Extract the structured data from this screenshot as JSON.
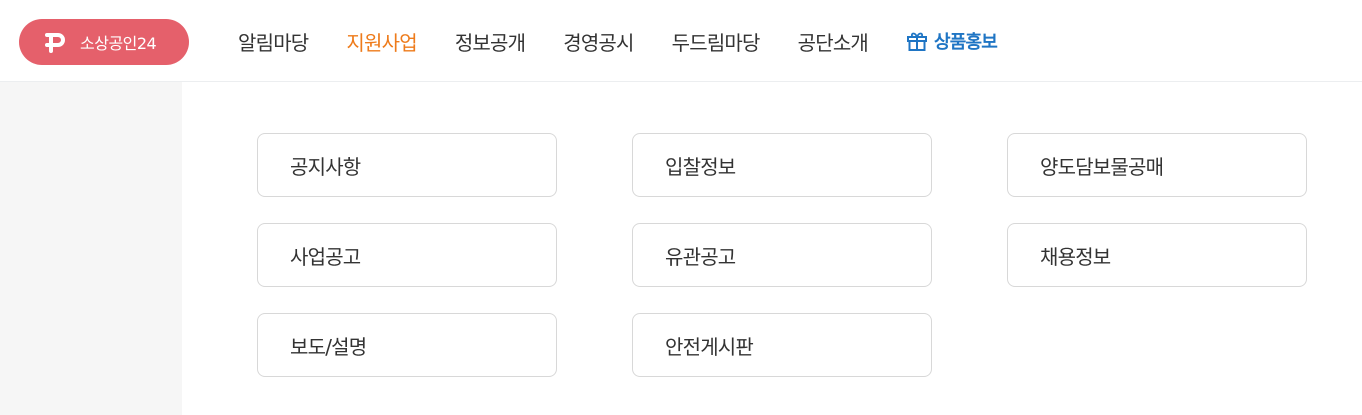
{
  "header": {
    "logo_text": "소상공인24",
    "nav": [
      {
        "label": "알림마당",
        "active": false
      },
      {
        "label": "지원사업",
        "active": true
      },
      {
        "label": "정보공개",
        "active": false
      },
      {
        "label": "경영공시",
        "active": false
      },
      {
        "label": "두드림마당",
        "active": false
      },
      {
        "label": "공단소개",
        "active": false
      }
    ],
    "promo": {
      "label": "상품홍보",
      "icon": "gift-icon"
    }
  },
  "submenu": {
    "items": [
      {
        "label": "공지사항"
      },
      {
        "label": "입찰정보"
      },
      {
        "label": "양도담보물공매"
      },
      {
        "label": "사업공고"
      },
      {
        "label": "유관공고"
      },
      {
        "label": "채용정보"
      },
      {
        "label": "보도/설명"
      },
      {
        "label": "안전게시판"
      }
    ]
  },
  "colors": {
    "brand": "#e5606b",
    "active_nav": "#ee7b1b",
    "promo": "#1f75c4",
    "text": "#333333",
    "card_border": "#d8d8d8",
    "side_panel": "#f6f6f6"
  }
}
